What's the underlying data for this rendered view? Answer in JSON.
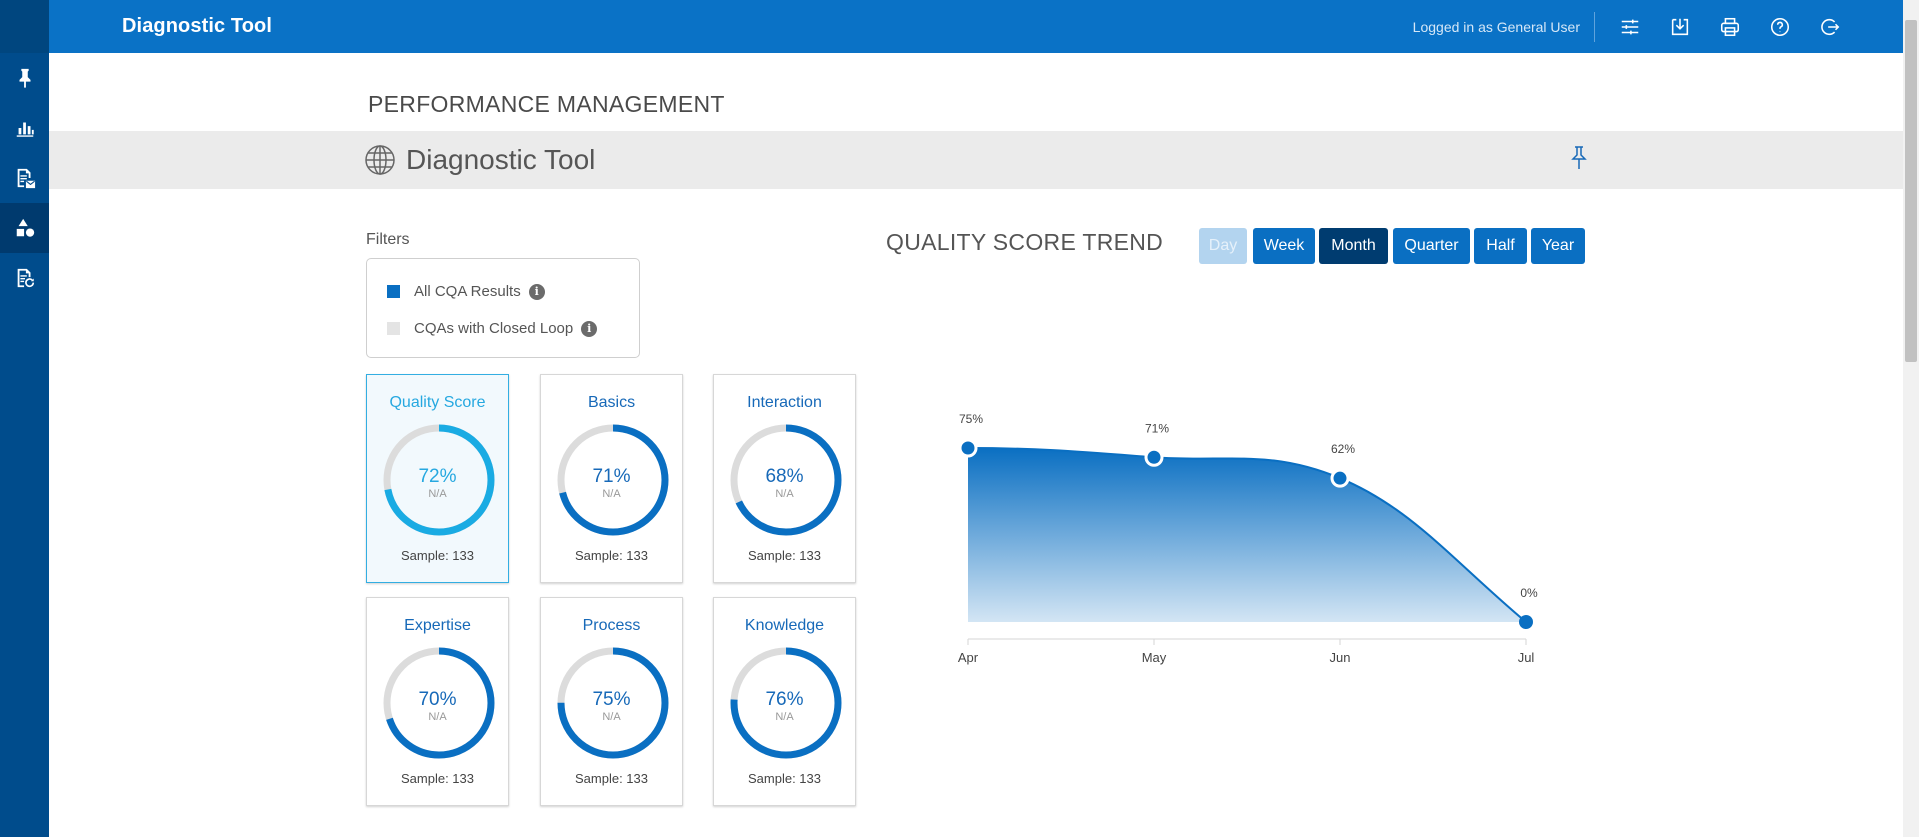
{
  "header": {
    "app_title": "Diagnostic Tool",
    "login_text": "Logged in as General User",
    "icons": [
      "settings-sliders-icon",
      "download-icon",
      "print-icon",
      "help-icon",
      "logout-icon"
    ]
  },
  "sidebar": {
    "items": [
      "pin-icon",
      "bar-chart-icon",
      "report-mail-icon",
      "shapes-icon",
      "report-refresh-icon"
    ],
    "active_index": 3
  },
  "page": {
    "heading": "PERFORMANCE MANAGEMENT",
    "section_title": "Diagnostic Tool"
  },
  "filters": {
    "label": "Filters",
    "options": [
      {
        "label": "All CQA Results",
        "color": "#0a6fc2",
        "selected": true
      },
      {
        "label": "CQAs with Closed Loop",
        "color": "#e4e4e4",
        "selected": false
      }
    ],
    "info_glyph": "i"
  },
  "metrics": [
    {
      "title": "Quality Score",
      "value": 72,
      "pct": "72%",
      "sub": "N/A",
      "sample": "Sample: 133",
      "selected": true
    },
    {
      "title": "Basics",
      "value": 71,
      "pct": "71%",
      "sub": "N/A",
      "sample": "Sample: 133",
      "selected": false
    },
    {
      "title": "Interaction",
      "value": 68,
      "pct": "68%",
      "sub": "N/A",
      "sample": "Sample: 133",
      "selected": false
    },
    {
      "title": "Expertise",
      "value": 70,
      "pct": "70%",
      "sub": "N/A",
      "sample": "Sample: 133",
      "selected": false
    },
    {
      "title": "Process",
      "value": 75,
      "pct": "75%",
      "sub": "N/A",
      "sample": "Sample: 133",
      "selected": false
    },
    {
      "title": "Knowledge",
      "value": 76,
      "pct": "76%",
      "sub": "N/A",
      "sample": "Sample: 133",
      "selected": false
    }
  ],
  "trend": {
    "title": "QUALITY SCORE TREND",
    "periods": [
      {
        "label": "Day",
        "state": "disabled"
      },
      {
        "label": "Week",
        "state": "normal"
      },
      {
        "label": "Month",
        "state": "active"
      },
      {
        "label": "Quarter",
        "state": "normal"
      },
      {
        "label": "Half",
        "state": "normal"
      },
      {
        "label": "Year",
        "state": "normal"
      }
    ]
  },
  "chart_data": {
    "type": "area",
    "title": "QUALITY SCORE TREND",
    "categories": [
      "Apr",
      "May",
      "Jun",
      "Jul"
    ],
    "values": [
      75,
      71,
      62,
      0
    ],
    "data_labels": [
      "75%",
      "71%",
      "62%",
      "0%"
    ],
    "ylim": [
      0,
      100
    ],
    "grid": false,
    "color": "#0a6fc2"
  },
  "colors": {
    "brand": "#0a72c6",
    "ring_primary": "#0a6fc2",
    "ring_selected": "#1aabe3",
    "ring_track": "#dcdcdc"
  }
}
